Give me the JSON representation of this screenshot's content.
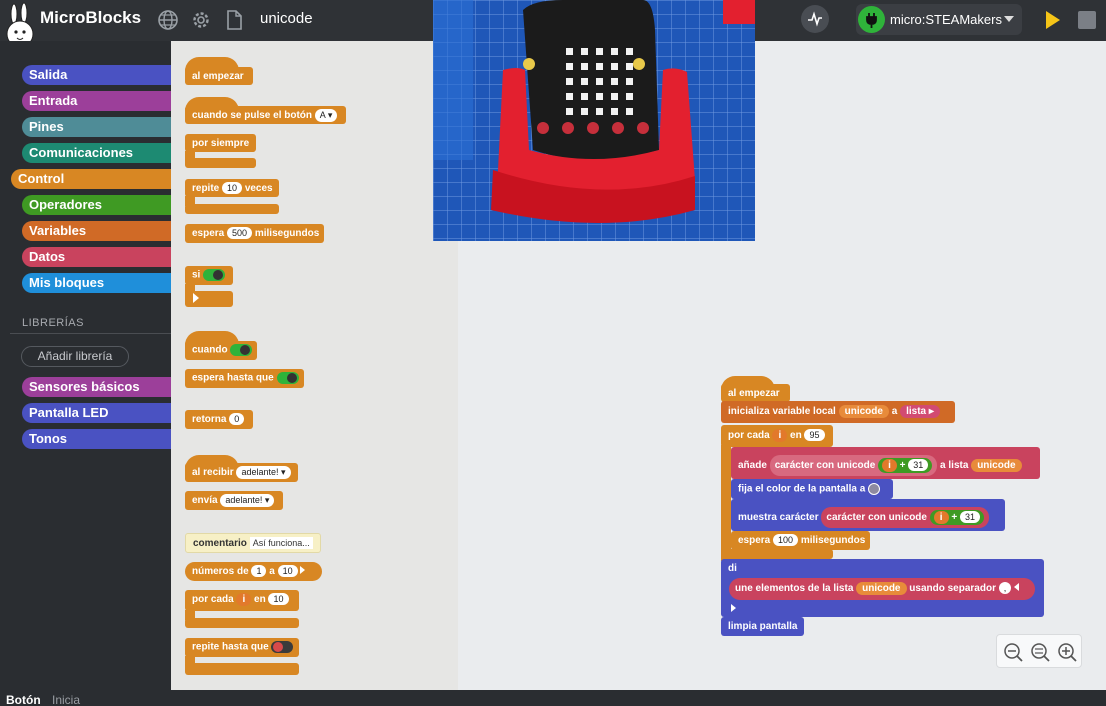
{
  "app": {
    "brand": "MicroBlocks",
    "project_name": "unicode",
    "board_name": "micro:STEAMakers"
  },
  "categories": [
    {
      "label": "Salida",
      "color": "#4a52c2"
    },
    {
      "label": "Entrada",
      "color": "#9c3f9a"
    },
    {
      "label": "Pines",
      "color": "#4f8c97"
    },
    {
      "label": "Comunicaciones",
      "color": "#1d8a72"
    },
    {
      "label": "Control",
      "color": "#d88723"
    },
    {
      "label": "Operadores",
      "color": "#3f9a23"
    },
    {
      "label": "Variables",
      "color": "#d06a26"
    },
    {
      "label": "Datos",
      "color": "#c9435e"
    },
    {
      "label": "Mis bloques",
      "color": "#1f8fda"
    }
  ],
  "libraries": {
    "header": "LIBRERÍAS",
    "add_button": "Añadir librería",
    "items": [
      {
        "label": "Sensores básicos",
        "color": "#9c3f9a"
      },
      {
        "label": "Pantalla LED",
        "color": "#4a52c2"
      },
      {
        "label": "Tonos",
        "color": "#4a52c2"
      }
    ]
  },
  "palette": {
    "al_empezar": "al empezar",
    "cuando_boton": "cuando se pulse el botón",
    "boton_value": "A",
    "por_siempre": "por siempre",
    "repite": "repite",
    "repite_n": "10",
    "veces": "veces",
    "espera": "espera",
    "espera_n": "500",
    "milisegundos": "milisegundos",
    "si": "si",
    "cuando": "cuando",
    "espera_hasta_que": "espera hasta que",
    "retorna": "retorna",
    "retorna_n": "0",
    "al_recibir": "al recibir",
    "mensaje": "adelante!",
    "envia": "envía",
    "comentario": "comentario",
    "comentario_text": "Así funciona...",
    "numeros_de": "números de",
    "num_from": "1",
    "a": "a",
    "num_to": "10",
    "por_cada": "por cada",
    "var_i": "i",
    "en": "en",
    "en_n": "10",
    "repite_hasta_que": "repite hasta que"
  },
  "script": {
    "al_empezar": "al empezar",
    "inicializa": "inicializa variable local",
    "var_unicode": "unicode",
    "a": "a",
    "lista": "lista",
    "por_cada": "por cada",
    "var_i": "i",
    "en": "en",
    "en_n": "95",
    "anade": "añade",
    "caracter_unicode": "carácter con unicode",
    "plus": "+",
    "n31": "31",
    "a_lista": "a lista",
    "fija_color": "fija el color de la pantalla a",
    "muestra": "muestra carácter",
    "espera": "espera",
    "espera_n": "100",
    "milisegundos": "milisegundos",
    "di": "di",
    "une": "une elementos de la lista",
    "usando_sep": "usando separador",
    "sep": ",",
    "limpia": "limpia pantalla"
  },
  "status": {
    "left": "Botón",
    "right": "Inicia"
  },
  "icons": [
    "microblocks-logo-icon",
    "globe-icon",
    "gear-icon",
    "file-icon",
    "graph-icon",
    "usb-plug-icon",
    "start-icon",
    "stop-icon",
    "zoom-out-icon",
    "zoom-reset-icon",
    "zoom-in-icon",
    "trash-icon"
  ],
  "colors": {
    "control": "#d88723",
    "variables": "#d06a26",
    "datos": "#c9435e",
    "salida": "#4a52c2",
    "operadores": "#3f9a23"
  }
}
